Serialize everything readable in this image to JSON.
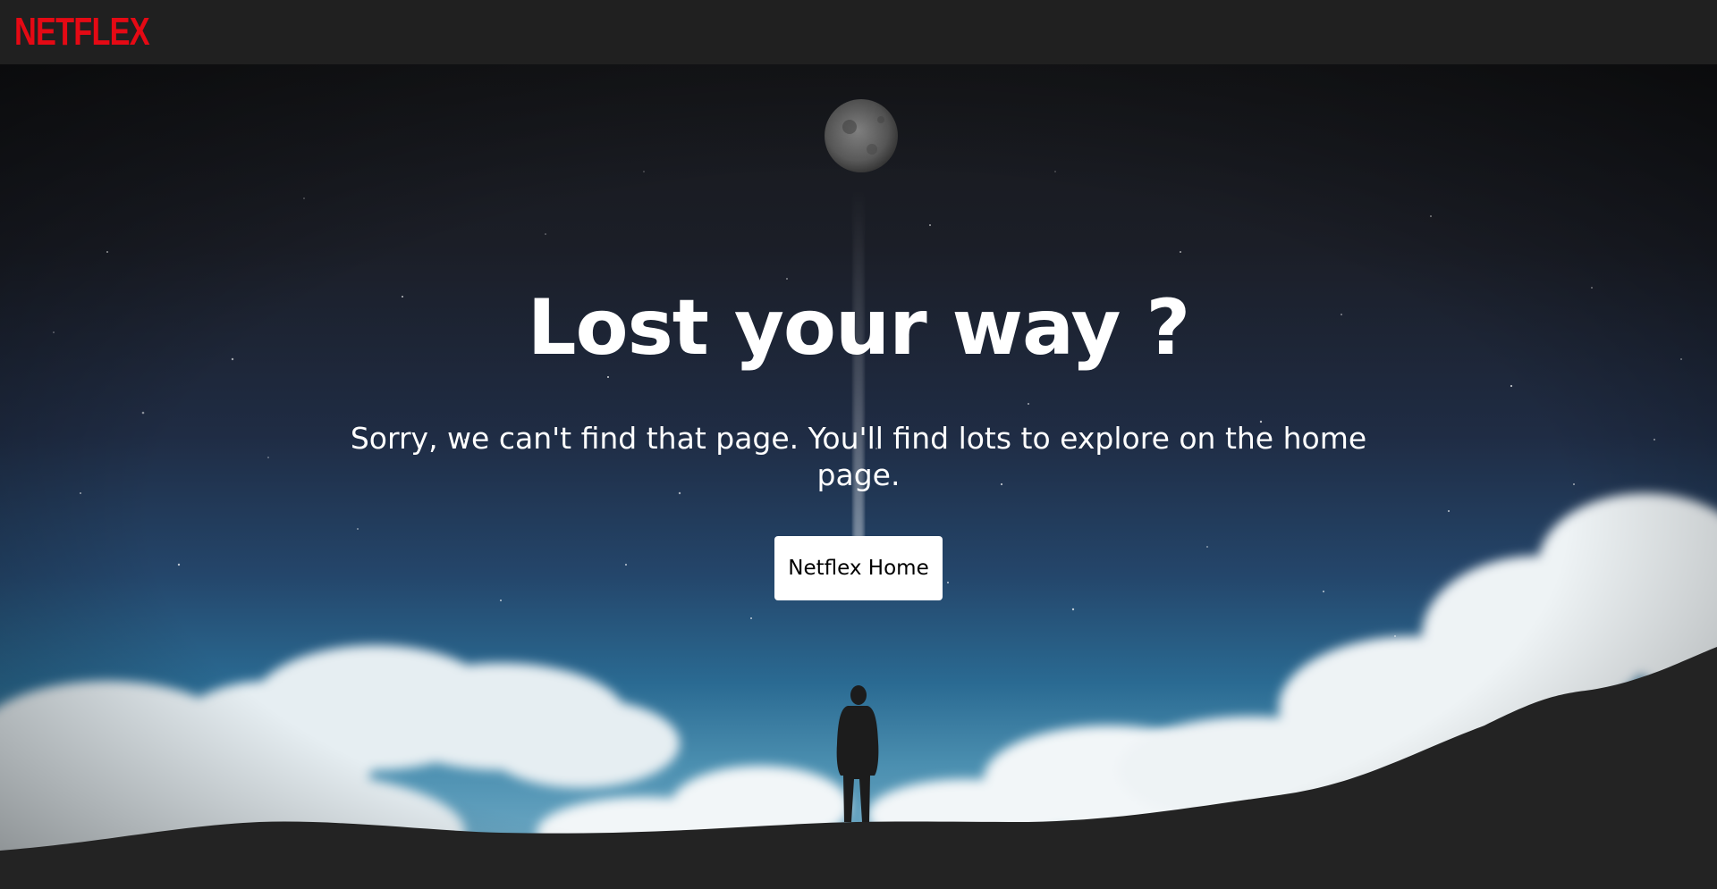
{
  "header": {
    "logo_text": "NETFLEX"
  },
  "main": {
    "title": "Lost your way ?",
    "subtitle": "Sorry, we can't find that page. You'll find lots to explore on the home page.",
    "home_button_label": "Netflex Home"
  },
  "colors": {
    "brand": "#e50914",
    "navbar_bg": "#202020",
    "button_bg": "#ffffff",
    "button_text": "#000000",
    "ground": "#232323"
  },
  "icons": {
    "background": "night-sky-illustration",
    "moon": "moon-icon",
    "silhouette": "person-silhouette"
  }
}
